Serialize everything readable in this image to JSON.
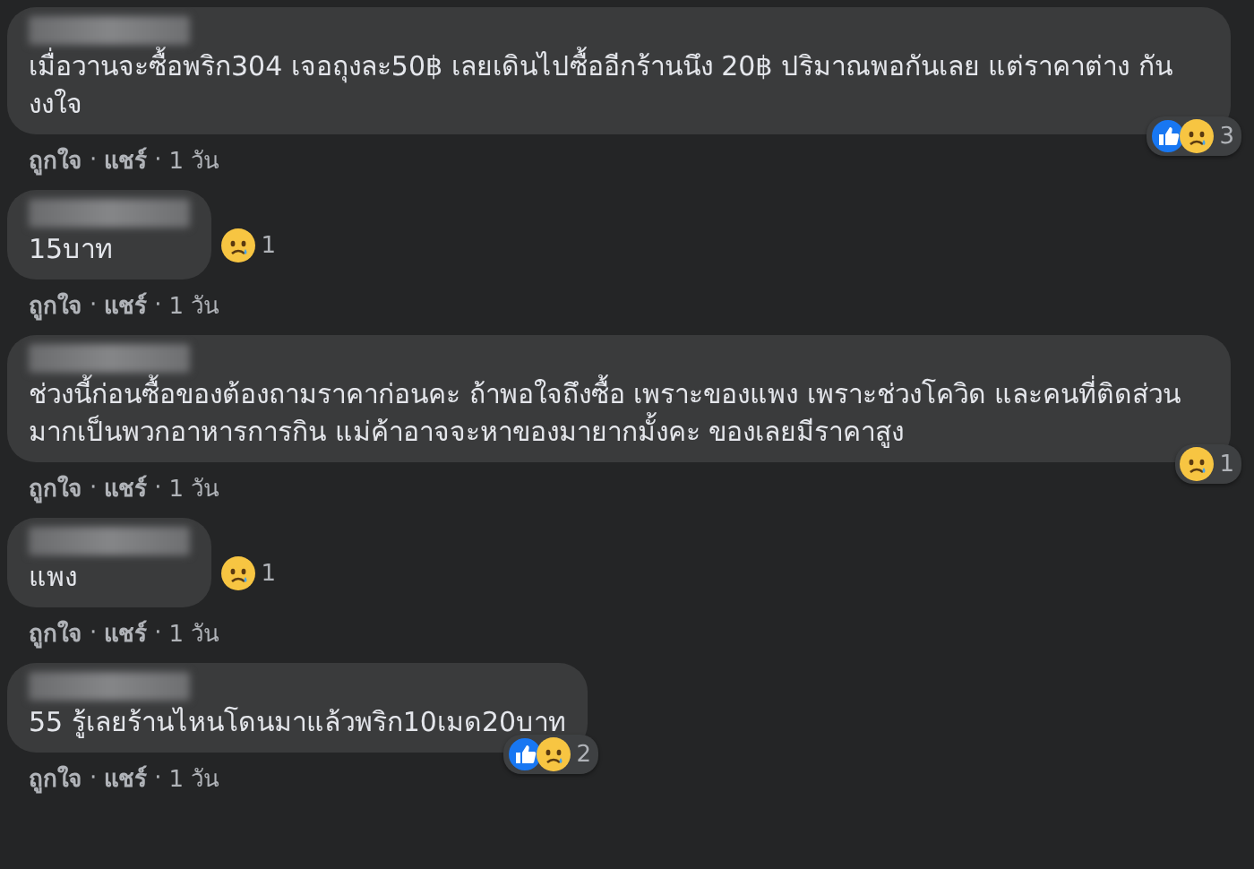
{
  "separator": "·",
  "comments": [
    {
      "text": "เมื่อวานจะซื้อพริก304 เจอถุงละ50฿ เลยเดินไปซื้ออีกร้านนึง 20฿ ปริมาณพอกันเลย แต่ราคาต่าง กัน งงใจ",
      "kind": "corner",
      "reactions": [
        {
          "kind": "like"
        },
        {
          "kind": "sad"
        }
      ],
      "count": "3",
      "actions": [
        "ถูกใจ",
        "แชร์"
      ],
      "time": "1 วัน"
    },
    {
      "text": "15บาท",
      "kind": "side",
      "reactions": [
        {
          "kind": "sad"
        }
      ],
      "count": "1",
      "actions": [
        "ถูกใจ",
        "แชร์"
      ],
      "time": "1 วัน"
    },
    {
      "text": "ช่วงนี้ก่อนซื้อของต้องถามราคาก่อนคะ ถ้าพอใจถึงซื้อ เพราะของแพง เพราะช่วงโควิด และคนที่ติดส่วนมากเป็นพวกอาหารการกิน แม่ค้าอาจจะหาของมายากมั้งคะ ของเลยมีราคาสูง",
      "kind": "corner",
      "reactions": [
        {
          "kind": "sad"
        }
      ],
      "count": "1",
      "actions": [
        "ถูกใจ",
        "แชร์"
      ],
      "time": "1 วัน"
    },
    {
      "text": "แพง",
      "kind": "side",
      "reactions": [
        {
          "kind": "sad"
        }
      ],
      "count": "1",
      "actions": [
        "ถูกใจ",
        "แชร์"
      ],
      "time": "1 วัน"
    },
    {
      "text": "55 รู้เลยร้านไหนโดนมาแล้วพริก10เมด20บาท",
      "kind": "corner",
      "reactions": [
        {
          "kind": "like"
        },
        {
          "kind": "sad"
        }
      ],
      "count": "2",
      "actions": [
        "ถูกใจ",
        "แชร์"
      ],
      "time": "1 วัน"
    }
  ]
}
